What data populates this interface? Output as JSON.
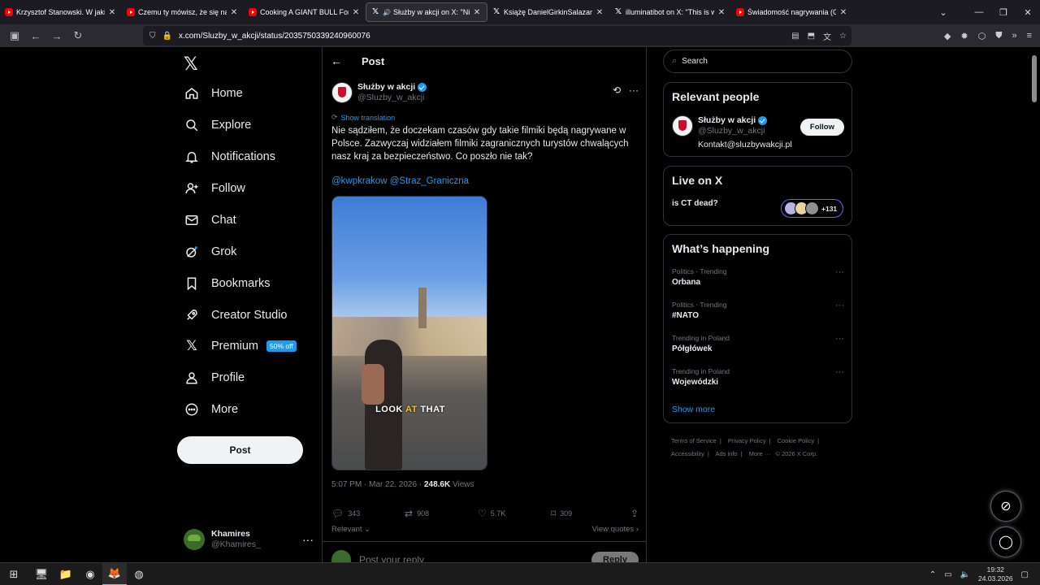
{
  "browser": {
    "tabs": [
      {
        "title": "Krzysztof Stanowski. W jakiej sy",
        "icon": "youtube-icon",
        "active": false
      },
      {
        "title": "Czemu ty mówisz, że się na cieb",
        "icon": "youtube-icon",
        "active": false
      },
      {
        "title": "Cooking A GIANT BULL For A G",
        "icon": "youtube-icon",
        "active": false
      },
      {
        "title": "Służby w akcji on X: \"Nie sę",
        "icon": "x-icon",
        "active": true
      },
      {
        "title": "Książę DanielGirkinSalazar on X",
        "icon": "x-icon",
        "active": false
      },
      {
        "title": "illuminatibot on X: \"This is what",
        "icon": "x-icon",
        "active": false
      },
      {
        "title": "Świadomość nagrywania (Giełd",
        "icon": "youtube-icon",
        "active": false
      }
    ],
    "url": "x.com/Sluzby_w_akcji/status/2035750339240960076"
  },
  "nav": {
    "items": [
      {
        "label": "Home",
        "icon": "home-icon"
      },
      {
        "label": "Explore",
        "icon": "search-icon"
      },
      {
        "label": "Notifications",
        "icon": "bell-icon"
      },
      {
        "label": "Follow",
        "icon": "add-person-icon"
      },
      {
        "label": "Chat",
        "icon": "mail-icon"
      },
      {
        "label": "Grok",
        "icon": "grok-icon"
      },
      {
        "label": "Bookmarks",
        "icon": "bookmark-icon"
      },
      {
        "label": "Creator Studio",
        "icon": "rocket-icon"
      },
      {
        "label": "Premium",
        "icon": "x-logo-icon"
      },
      {
        "label": "Profile",
        "icon": "person-icon"
      },
      {
        "label": "More",
        "icon": "more-circle-icon"
      }
    ],
    "premium_badge": "50% off",
    "post_button": "Post",
    "account": {
      "name": "Khamires",
      "handle": "@Khamires_"
    }
  },
  "post": {
    "header": "Post",
    "author_name": "Służby w akcji",
    "author_handle": "@Sluzby_w_akcji",
    "show_translation": "Show translation",
    "text": "Nie sądziłem, że doczekam czasów gdy takie filmiki będą nagrywane w Polsce. Zazwyczaj widziałem filmiki zagranicznych turystów chwalących nasz kraj za bezpieczeństwo. Co poszło nie tak?",
    "mentions": "@kwpkrakow @Straz_Graniczna",
    "video_caption_1": "LOOK",
    "video_caption_2": "AT",
    "video_caption_3": "THAT",
    "timestamp": "5:07 PM · Mar 22, 2026 ·",
    "views_count": "248.6K",
    "views_label": "Views",
    "replies": "343",
    "reposts": "908",
    "likes": "5.7K",
    "bookmarks": "309",
    "sort_label": "Relevant",
    "view_quotes": "View quotes",
    "reply_placeholder": "Post your reply",
    "reply_button": "Reply"
  },
  "sidebar": {
    "search_placeholder": "Search",
    "relevant_title": "Relevant people",
    "relevant_person": {
      "name": "Służby w akcji",
      "handle": "@Sluzby_w_akcji",
      "bio": "Kontakt@sluzbywakcji.pl",
      "follow": "Follow"
    },
    "live_title": "Live on X",
    "live_item": "is CT dead?",
    "live_count": "+131",
    "happening_title": "What’s happening",
    "trends": [
      {
        "category": "Politics · Trending",
        "name": "Orbana"
      },
      {
        "category": "Politics · Trending",
        "name": "#NATO"
      },
      {
        "category": "Trending in Poland",
        "name": "Półgłówek"
      },
      {
        "category": "Trending in Poland",
        "name": "Wojewódzki"
      }
    ],
    "show_more": "Show more",
    "footer": [
      "Terms of Service",
      "Privacy Policy",
      "Cookie Policy",
      "Accessibility",
      "Ads info",
      "More ···",
      "© 2026 X Corp."
    ]
  },
  "taskbar": {
    "time": "19:32",
    "date": "24.03.2026"
  },
  "colors": {
    "accent": "#1d9bf0",
    "background": "#000000",
    "border": "#2f3336",
    "muted": "#71767b"
  }
}
